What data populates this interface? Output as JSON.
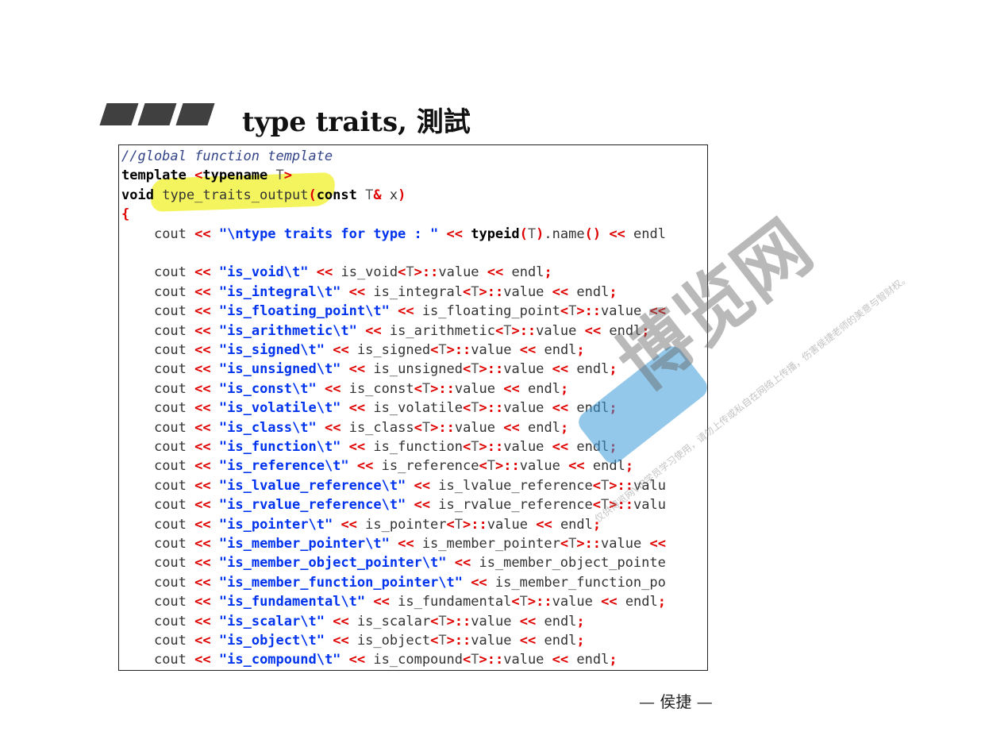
{
  "slide": {
    "title": "type traits, 測試",
    "footer": "— 侯捷 —"
  },
  "code": {
    "comment": "//global function template",
    "template_kw": "template",
    "lt": "<",
    "typename_kw": "typename",
    "T": "T",
    "gt": ">",
    "void_kw": "void",
    "func_name": "type_traits_output",
    "lparen": "(",
    "const_kw": "const",
    "amp": "&",
    "param": "x",
    "rparen": ")",
    "lbrace": "{",
    "indent": "    ",
    "cout": "cout",
    "ins": "<<",
    "first_str": "\"\\ntype traits for type : \"",
    "typeid_kw": "typeid",
    "name_call": ".name",
    "parens": "()",
    "endl": "endl",
    "scope": "::",
    "value": "value",
    "semi": ";",
    "lines": [
      {
        "str": "\"is_void\\t\"",
        "trait": "is_void",
        "tail": "endl;"
      },
      {
        "str": "\"is_integral\\t\"",
        "trait": "is_integral",
        "tail": "endl;"
      },
      {
        "str": "\"is_floating_point\\t\"",
        "trait": "is_floating_point",
        "tail": "<<"
      },
      {
        "str": "\"is_arithmetic\\t\"",
        "trait": "is_arithmetic",
        "tail": "endl;"
      },
      {
        "str": "\"is_signed\\t\"",
        "trait": "is_signed",
        "tail": "endl;"
      },
      {
        "str": "\"is_unsigned\\t\"",
        "trait": "is_unsigned",
        "tail": "endl;"
      },
      {
        "str": "\"is_const\\t\"",
        "trait": "is_const",
        "tail": "endl;"
      },
      {
        "str": "\"is_volatile\\t\"",
        "trait": "is_volatile",
        "tail": "endl;"
      },
      {
        "str": "\"is_class\\t\"",
        "trait": "is_class",
        "tail": "endl;"
      },
      {
        "str": "\"is_function\\t\"",
        "trait": "is_function",
        "tail": "endl;"
      },
      {
        "str": "\"is_reference\\t\"",
        "trait": "is_reference",
        "tail": "endl;"
      },
      {
        "str": "\"is_lvalue_reference\\t\"",
        "trait": "is_lvalue_reference",
        "tail": "valu"
      },
      {
        "str": "\"is_rvalue_reference\\t\"",
        "trait": "is_rvalue_reference",
        "tail": "valu"
      },
      {
        "str": "\"is_pointer\\t\"",
        "trait": "is_pointer",
        "tail": "endl;"
      },
      {
        "str": "\"is_member_pointer\\t\"",
        "trait": "is_member_pointer",
        "tail": "<<"
      },
      {
        "str": "\"is_member_object_pointer\\t\"",
        "trait": "is_member_object_pointe",
        "tail": ""
      },
      {
        "str": "\"is_member_function_pointer\\t\"",
        "trait": "is_member_function_po",
        "tail": ""
      },
      {
        "str": "\"is_fundamental\\t\"",
        "trait": "is_fundamental",
        "tail": "endl;"
      },
      {
        "str": "\"is_scalar\\t\"",
        "trait": "is_scalar",
        "tail": "endl;"
      },
      {
        "str": "\"is_object\\t\"",
        "trait": "is_object",
        "tail": "endl;"
      },
      {
        "str": "\"is_compound\\t\"",
        "trait": "is_compound",
        "tail": "endl;"
      }
    ]
  },
  "watermark": {
    "brand": "博览网",
    "notice": "仅供博览网VIP学员学习使用，请勿上传或私自在网络上传播，伤害侯捷老师的美意与智财权。",
    "logo_color": "#3a9bd8"
  }
}
